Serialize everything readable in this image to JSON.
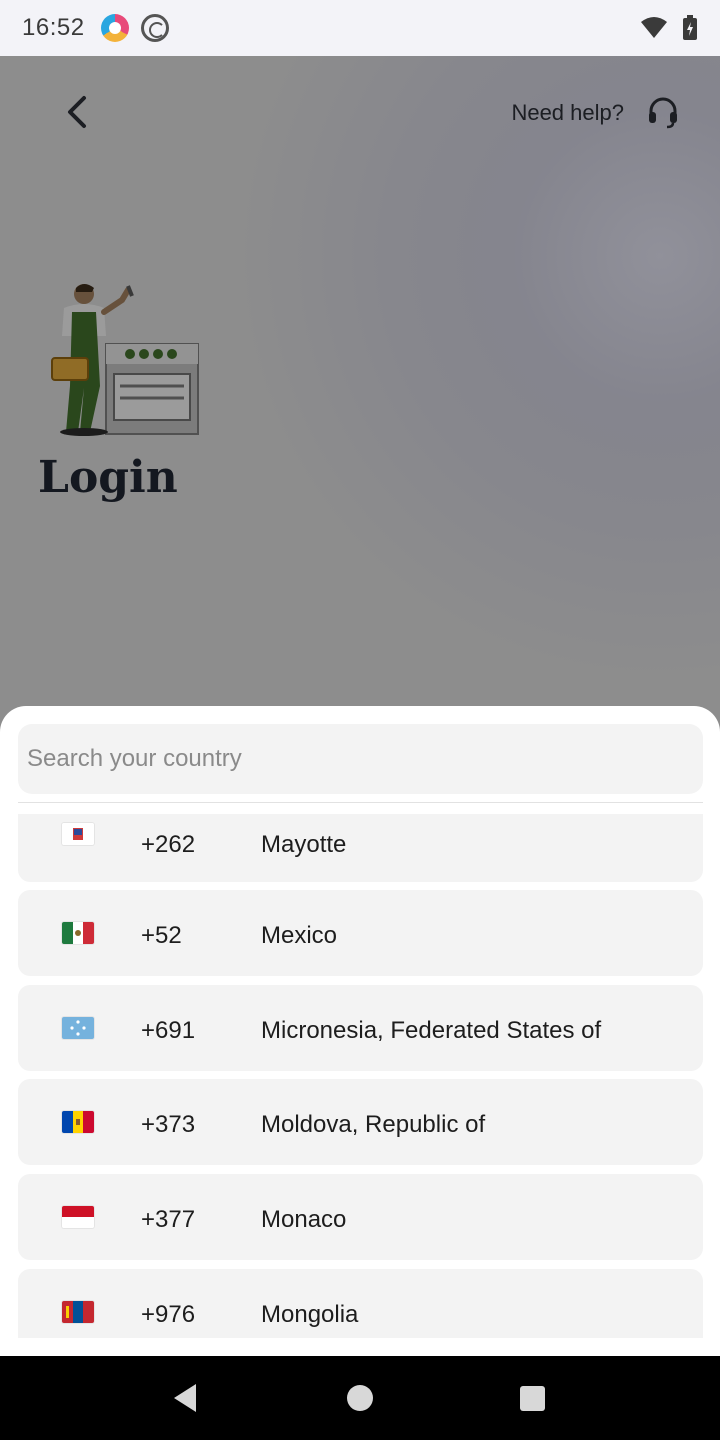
{
  "status_bar": {
    "time": "16:52",
    "icons": [
      "app-notification-icon",
      "at-sign-icon",
      "wifi-icon",
      "battery-charging-icon"
    ]
  },
  "header": {
    "back_icon": "chevron-left-icon",
    "help_label": "Need help?",
    "help_icon": "headset-icon"
  },
  "page": {
    "title": "Login"
  },
  "country_sheet": {
    "search_placeholder": "Search your country",
    "countries": [
      {
        "code": "+262",
        "name": "Mayotte",
        "flag": "flag-mayotte"
      },
      {
        "code": "+52",
        "name": "Mexico",
        "flag": "flag-mexico"
      },
      {
        "code": "+691",
        "name": "Micronesia, Federated States of",
        "flag": "flag-micronesia"
      },
      {
        "code": "+373",
        "name": "Moldova, Republic of",
        "flag": "flag-moldova"
      },
      {
        "code": "+377",
        "name": "Monaco",
        "flag": "flag-monaco"
      },
      {
        "code": "+976",
        "name": "Mongolia",
        "flag": "flag-mongolia"
      }
    ]
  },
  "nav_bar": {
    "icons": [
      "back-triangle-icon",
      "home-circle-icon",
      "recents-square-icon"
    ]
  }
}
